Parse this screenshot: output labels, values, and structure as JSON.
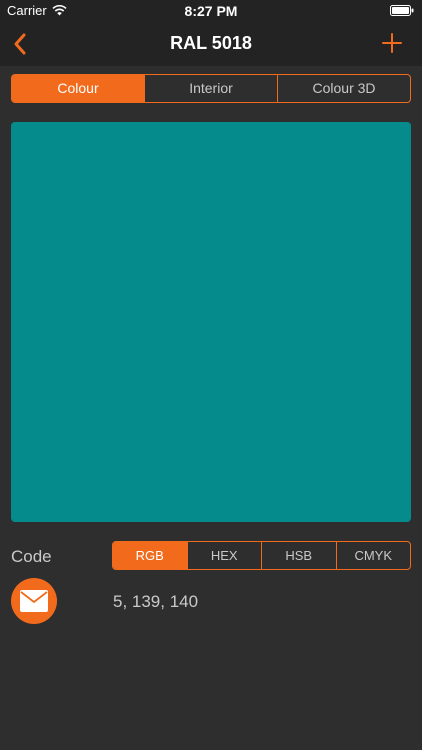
{
  "status_bar": {
    "carrier": "Carrier",
    "time": "8:27 PM"
  },
  "nav": {
    "title": "RAL 5018",
    "back_icon": "chevron-left-icon",
    "add_icon": "plus-icon"
  },
  "view_tabs": [
    {
      "label": "Colour",
      "active": true
    },
    {
      "label": "Interior",
      "active": false
    },
    {
      "label": "Colour 3D",
      "active": false
    }
  ],
  "swatch": {
    "color": "#058B8C"
  },
  "code": {
    "label": "Code",
    "tabs": [
      {
        "label": "RGB",
        "active": true
      },
      {
        "label": "HEX",
        "active": false
      },
      {
        "label": "HSB",
        "active": false
      },
      {
        "label": "CMYK",
        "active": false
      }
    ],
    "value": "5, 139, 140"
  },
  "colors": {
    "accent": "#F26B1D",
    "background": "#2E2E2E",
    "bar": "#232323"
  }
}
